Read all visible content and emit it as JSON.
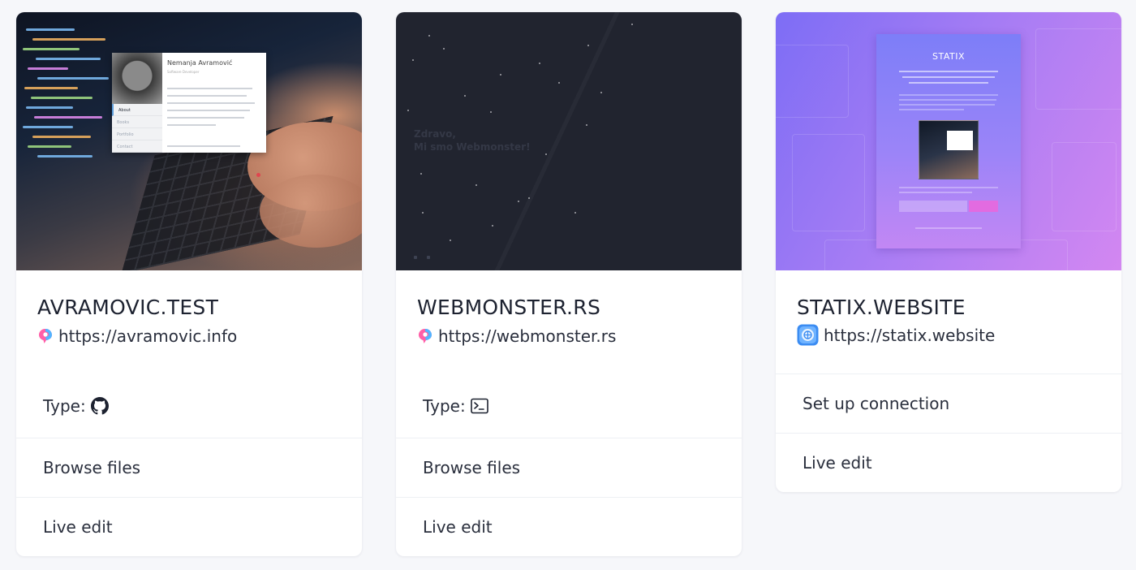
{
  "colors": {
    "page_background": "#f6f7fa",
    "card_background": "#ffffff",
    "text_primary": "#1d2230",
    "statix_gradient_start": "#7d6df5",
    "statix_gradient_end": "#d387f1"
  },
  "sites": [
    {
      "title": "AVRAMOVIC.TEST",
      "url": "https://avramovic.info",
      "url_icon": "pink-blue-bubble-icon",
      "type_label": "Type:",
      "type_icon": "github-icon",
      "actions": [
        "Browse files",
        "Live edit"
      ],
      "thumbnail": {
        "name": "Nemanja Avramović",
        "role": "Software Developer",
        "nav": [
          "About",
          "Books",
          "Portfolio",
          "Contact"
        ]
      }
    },
    {
      "title": "WEBMONSTER.RS",
      "url": "https://webmonster.rs",
      "url_icon": "pink-blue-bubble-icon",
      "type_label": "Type:",
      "type_icon": "terminal-icon",
      "actions": [
        "Browse files",
        "Live edit"
      ],
      "thumbnail": {
        "line1": "Zdravo,",
        "line2": "Mi smo Webmonster!"
      }
    },
    {
      "title": "STATIX.WEBSITE",
      "url": "https://statix.website",
      "url_icon": "statix-app-icon",
      "actions": [
        "Set up connection",
        "Live edit"
      ],
      "thumbnail": {
        "heading": "STATIX"
      }
    }
  ]
}
